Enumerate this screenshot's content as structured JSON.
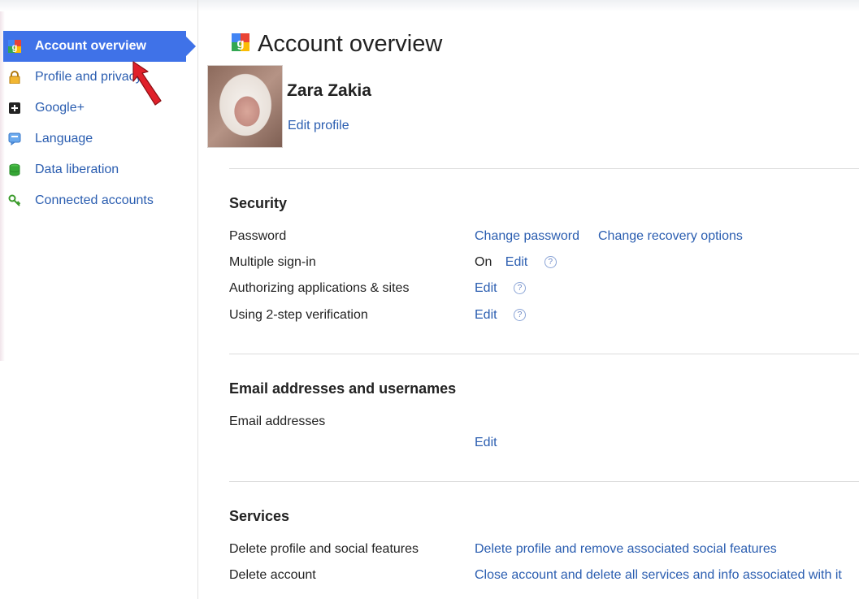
{
  "sidebar": {
    "items": [
      {
        "label": "Account overview",
        "icon": "google-g-icon",
        "active": true
      },
      {
        "label": "Profile and privacy",
        "icon": "lock-icon"
      },
      {
        "label": "Google+",
        "icon": "google-plus-icon"
      },
      {
        "label": "Language",
        "icon": "speech-bubble-icon"
      },
      {
        "label": "Data liberation",
        "icon": "database-icon"
      },
      {
        "label": "Connected accounts",
        "icon": "key-icon"
      }
    ]
  },
  "page": {
    "title": "Account overview",
    "user_name": "Zara Zakia",
    "edit_profile": "Edit profile"
  },
  "security": {
    "title": "Security",
    "rows": {
      "password": {
        "label": "Password",
        "change_password": "Change password",
        "change_recovery": "Change recovery options"
      },
      "multiple_signin": {
        "label": "Multiple sign-in",
        "status": "On",
        "edit": "Edit"
      },
      "authorizing": {
        "label": "Authorizing applications & sites",
        "edit": "Edit"
      },
      "two_step": {
        "label": "Using 2-step verification",
        "edit": "Edit"
      }
    }
  },
  "email": {
    "title": "Email addresses and usernames",
    "label": "Email addresses",
    "edit": "Edit"
  },
  "services": {
    "title": "Services",
    "rows": {
      "delete_profile": {
        "label": "Delete profile and social features",
        "link": "Delete profile and remove associated social features"
      },
      "delete_account": {
        "label": "Delete account",
        "link": "Close account and delete all services and info associated with it"
      }
    }
  },
  "colors": {
    "accent": "#3f72e8",
    "link": "#2a5db0",
    "pointer": "#e0202a"
  }
}
